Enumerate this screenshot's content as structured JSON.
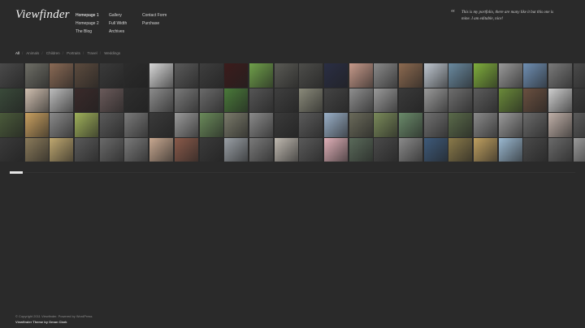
{
  "site": {
    "logo": "Viewfinder"
  },
  "nav": {
    "col1": [
      "Homepage 1",
      "Homepage 2",
      "The Blog"
    ],
    "col2": [
      "Gallery",
      "Full Width",
      "Archives"
    ],
    "col3": [
      "Contact Form",
      "Purchase"
    ]
  },
  "quote": {
    "mark": "“",
    "text": "This is my portfolio, there are many like it but this one is mine. I am editable, nice!"
  },
  "filters": [
    "All",
    "Animals",
    "Children",
    "Portraits",
    "Travel",
    "Weddings"
  ],
  "gallery": {
    "colors": [
      "#4a4a4a",
      "#6e6e66",
      "#8a6a55",
      "#5c4b3e",
      "#3a3a3a",
      "#2c2c2c",
      "#d8d8d8",
      "#5a5a5a",
      "#3e3e3e",
      "#3c1c1c",
      "#6fa04a",
      "#5a5a55",
      "#4d4d4a",
      "#2a2e44",
      "#c79a8a",
      "#8a8a8a",
      "#8c6a50",
      "#bfc7d0",
      "#6a8aa0",
      "#7fae3c",
      "#9a9a9a",
      "#6f8fb3",
      "#7a7a7a",
      "#4a4a4a",
      "#3a4a3a",
      "#d0c0b0",
      "#bdbdbd",
      "#3a2a2a",
      "#6a5a5a",
      "#2e2e2e",
      "#8c8c8c",
      "#7a7a7a",
      "#6a6a6a",
      "#4a7a3a",
      "#555555",
      "#3f3f3f",
      "#8a8a7a",
      "#444444",
      "#8f8f8f",
      "#9a9a9a",
      "#3a3a3a",
      "#9a9a9a",
      "#6e6e6e",
      "#5c5c5c",
      "#6a8a3a",
      "#6a5040",
      "#cfcfcf",
      "#3a3a3a",
      "#4a5a3a",
      "#c9a060",
      "#8a8a8a",
      "#9fb05a",
      "#5a5a5a",
      "#7a7a7a",
      "#3a3a3a",
      "#9a9a9a",
      "#6a8a5a",
      "#7a7a6a",
      "#8a8a8a",
      "#3a3a3a",
      "#5a5a5a",
      "#9ab0c8",
      "#6a6a5a",
      "#7a8a5a",
      "#6a8a6a",
      "#707070",
      "#5a6a4a",
      "#8a8a8a",
      "#9a9a9a",
      "#6a6a6a",
      "#c0b0a8",
      "#5a5a5a",
      "#3a3a3a",
      "#8a7a5a",
      "#c0a870",
      "#5a5a5a",
      "#6a6a6a",
      "#7a7a7a",
      "#c8a890",
      "#8a5a4a",
      "#3a3a3a",
      "#9aa0a6",
      "#7a7a7a",
      "#bfb9b0",
      "#5a5a5a",
      "#e0b0b8",
      "#5a6a5a",
      "#4a4a4a",
      "#8a8a8a",
      "#3e5a7a",
      "#8a7a4a",
      "#c0a060",
      "#9ab8d0",
      "#4a4a4a",
      "#6a6a6a",
      "#9a9a9a"
    ]
  },
  "footer": {
    "line1": "© Copyright 2011 Viewfinder. Powered by WordPress",
    "line2": "Viewfinder Theme by Oman Clark"
  }
}
